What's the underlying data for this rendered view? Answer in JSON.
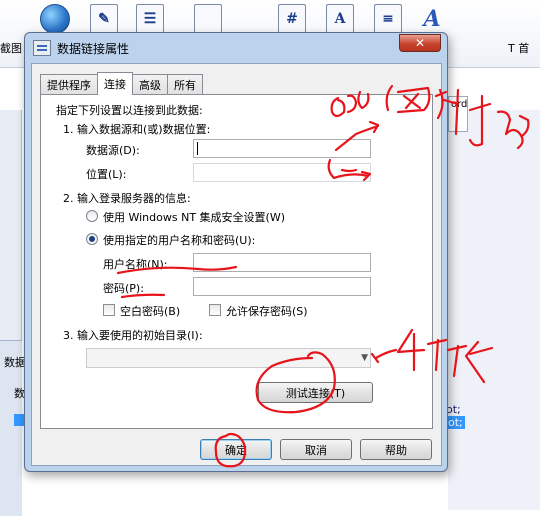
{
  "background": {
    "toolbar_icons": [
      "A",
      "#"
    ],
    "left_label": "截图",
    "right_label": "T 首",
    "left_panel_label": "数据",
    "left_panel_label2": "数",
    "right_top_text": "ord",
    "right_code_1": "ot;",
    "right_code_2": "ot;"
  },
  "dialog": {
    "title": "数据链接属性",
    "close_glyph": "✕",
    "tabs": [
      {
        "label": "提供程序"
      },
      {
        "label": "连接"
      },
      {
        "label": "高级"
      },
      {
        "label": "所有"
      }
    ],
    "instruction": "指定下列设置以连接到此数据:",
    "step1": "1. 输入数据源和(或)数据位置:",
    "datasource_label": "数据源(D):",
    "datasource_value": "",
    "location_label": "位置(L):",
    "location_value": "",
    "step2": "2. 输入登录服务器的信息:",
    "radio_nt": "使用 Windows NT 集成安全设置(W)",
    "radio_specific": "使用指定的用户名称和密码(U):",
    "username_label": "用户名称(N):",
    "username_value": "",
    "password_label": "密码(P):",
    "password_value": "",
    "blank_password": "空白密码(B)",
    "save_password": "允许保存密码(S)",
    "step3": "3. 输入要使用的初始目录(I):",
    "catalog_value": "",
    "test_button": "测试连接(T)",
    "ok_button": "确定",
    "cancel_button": "取消",
    "help_button": "帮助"
  },
  "annotation_color": "#e8141c"
}
